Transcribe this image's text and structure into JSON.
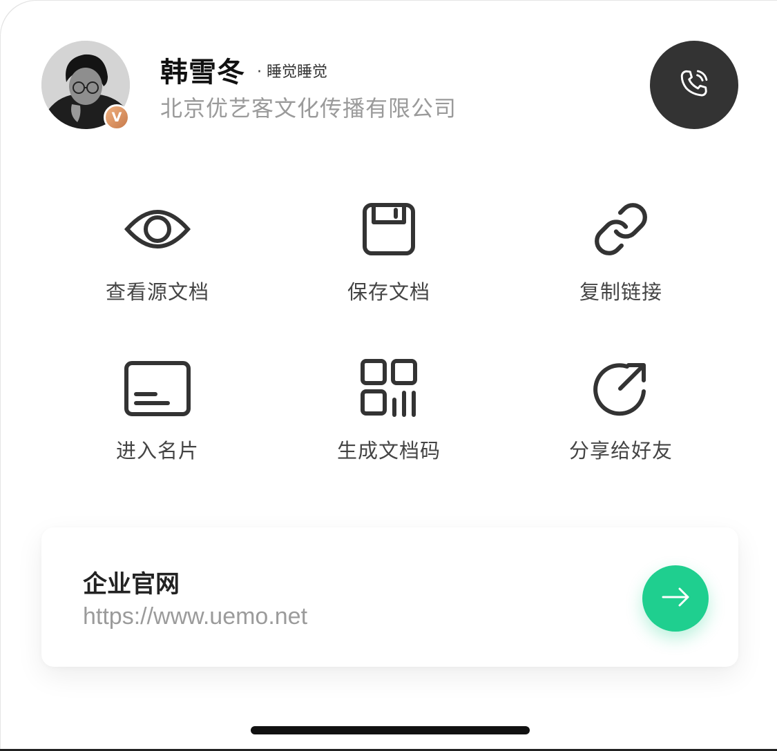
{
  "profile": {
    "name": "韩雪冬",
    "title_tag": "· 睡觉睡觉",
    "company": "北京优艺客文化传播有限公司",
    "verified_badge": "V"
  },
  "actions": [
    {
      "label": "查看源文档",
      "icon": "eye-icon"
    },
    {
      "label": "保存文档",
      "icon": "floppy-disk-icon"
    },
    {
      "label": "复制链接",
      "icon": "link-icon"
    },
    {
      "label": "进入名片",
      "icon": "card-icon"
    },
    {
      "label": "生成文档码",
      "icon": "qr-code-icon"
    },
    {
      "label": "分享给好友",
      "icon": "share-arrow-icon"
    }
  ],
  "website_card": {
    "title": "企业官网",
    "url": "https://www.uemo.net"
  },
  "colors": {
    "call_button": "#333333",
    "go_button": "#1fcf8f",
    "badge": "#d48a5c",
    "icon_stroke": "#333333"
  }
}
